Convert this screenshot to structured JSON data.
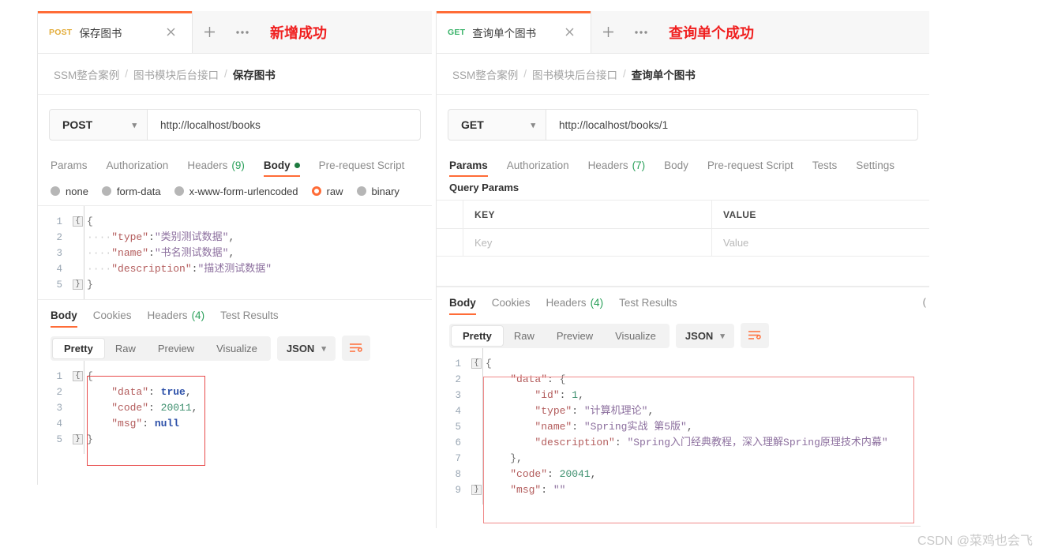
{
  "watermark": "CSDN @菜鸡也会飞",
  "panels": [
    {
      "id": "left",
      "tab": {
        "method": "POST",
        "title": "保存图书",
        "close_icon": "close-icon",
        "add_icon": "plus-icon",
        "more_icon": "ellipsis-icon"
      },
      "annotation": "新增成功",
      "breadcrumb": {
        "root": "SSM整合案例",
        "group": "图书模块后台接口",
        "current": "保存图书",
        "separator": "/"
      },
      "request": {
        "method": "POST",
        "url": "http://localhost/books",
        "tabs": [
          {
            "label": "Params",
            "count": "",
            "active": false,
            "dot": false
          },
          {
            "label": "Authorization",
            "count": "",
            "active": false,
            "dot": false
          },
          {
            "label": "Headers",
            "count": "(9)",
            "active": false,
            "dot": false
          },
          {
            "label": "Body",
            "count": "",
            "active": true,
            "dot": true
          },
          {
            "label": "Pre-request Script",
            "count": "",
            "active": false,
            "dot": false
          }
        ],
        "body_types": [
          {
            "label": "none",
            "selected": false
          },
          {
            "label": "form-data",
            "selected": false
          },
          {
            "label": "x-www-form-urlencoded",
            "selected": false
          },
          {
            "label": "raw",
            "selected": true
          },
          {
            "label": "binary",
            "selected": false
          }
        ],
        "body_lines": [
          {
            "n": "1",
            "fold": "open",
            "segments": [
              {
                "t": "{",
                "c": "brace"
              }
            ]
          },
          {
            "n": "2",
            "fold": "",
            "segments": [
              {
                "t": "····",
                "c": "dots"
              },
              {
                "t": "\"type\"",
                "c": "k"
              },
              {
                "t": ":",
                "c": "p"
              },
              {
                "t": "\"类别测试数据\"",
                "c": "s"
              },
              {
                "t": ",",
                "c": "p"
              }
            ]
          },
          {
            "n": "3",
            "fold": "",
            "segments": [
              {
                "t": "····",
                "c": "dots"
              },
              {
                "t": "\"name\"",
                "c": "k"
              },
              {
                "t": ":",
                "c": "p"
              },
              {
                "t": "\"书名测试数据\"",
                "c": "s"
              },
              {
                "t": ",",
                "c": "p"
              }
            ]
          },
          {
            "n": "4",
            "fold": "",
            "segments": [
              {
                "t": "····",
                "c": "dots"
              },
              {
                "t": "\"description\"",
                "c": "k"
              },
              {
                "t": ":",
                "c": "p"
              },
              {
                "t": "\"描述测试数据\"",
                "c": "s"
              }
            ]
          },
          {
            "n": "5",
            "fold": "close",
            "segments": [
              {
                "t": "}",
                "c": "brace"
              }
            ]
          }
        ]
      },
      "response": {
        "tabs": [
          {
            "label": "Body",
            "count": "",
            "active": true
          },
          {
            "label": "Cookies",
            "count": "",
            "active": false
          },
          {
            "label": "Headers",
            "count": "(4)",
            "active": false
          },
          {
            "label": "Test Results",
            "count": "",
            "active": false
          }
        ],
        "status": "",
        "view_modes": [
          {
            "label": "Pretty",
            "active": true
          },
          {
            "label": "Raw",
            "active": false
          },
          {
            "label": "Preview",
            "active": false
          },
          {
            "label": "Visualize",
            "active": false
          }
        ],
        "format": "JSON",
        "wrap_icon": "wrap-text-icon",
        "body_lines": [
          {
            "n": "1",
            "fold": "open",
            "segments": [
              {
                "t": "{",
                "c": "brace"
              }
            ]
          },
          {
            "n": "2",
            "fold": "",
            "segments": [
              {
                "t": "    ",
                "c": "p"
              },
              {
                "t": "\"data\"",
                "c": "k"
              },
              {
                "t": ": ",
                "c": "p"
              },
              {
                "t": "true",
                "c": "b"
              },
              {
                "t": ",",
                "c": "p"
              }
            ]
          },
          {
            "n": "3",
            "fold": "",
            "segments": [
              {
                "t": "    ",
                "c": "p"
              },
              {
                "t": "\"code\"",
                "c": "k"
              },
              {
                "t": ": ",
                "c": "p"
              },
              {
                "t": "20011",
                "c": "n"
              },
              {
                "t": ",",
                "c": "p"
              }
            ]
          },
          {
            "n": "4",
            "fold": "",
            "segments": [
              {
                "t": "    ",
                "c": "p"
              },
              {
                "t": "\"msg\"",
                "c": "k"
              },
              {
                "t": ": ",
                "c": "p"
              },
              {
                "t": "null",
                "c": "b"
              }
            ]
          },
          {
            "n": "5",
            "fold": "close",
            "segments": [
              {
                "t": "}",
                "c": "brace"
              }
            ]
          }
        ]
      }
    },
    {
      "id": "right",
      "tab": {
        "method": "GET",
        "title": "查询单个图书",
        "close_icon": "close-icon",
        "add_icon": "plus-icon",
        "more_icon": "ellipsis-icon"
      },
      "annotation": "查询单个成功",
      "breadcrumb": {
        "root": "SSM整合案例",
        "group": "图书模块后台接口",
        "current": "查询单个图书",
        "separator": "/"
      },
      "request": {
        "method": "GET",
        "url": "http://localhost/books/1",
        "tabs": [
          {
            "label": "Params",
            "count": "",
            "active": true,
            "dot": false
          },
          {
            "label": "Authorization",
            "count": "",
            "active": false,
            "dot": false
          },
          {
            "label": "Headers",
            "count": "(7)",
            "active": false,
            "dot": false
          },
          {
            "label": "Body",
            "count": "",
            "active": false,
            "dot": false
          },
          {
            "label": "Pre-request Script",
            "count": "",
            "active": false,
            "dot": false
          },
          {
            "label": "Tests",
            "count": "",
            "active": false,
            "dot": false
          },
          {
            "label": "Settings",
            "count": "",
            "active": false,
            "dot": false
          }
        ],
        "query_params": {
          "title": "Query Params",
          "headers": {
            "key": "KEY",
            "value": "VALUE"
          },
          "rows": [
            {
              "key_placeholder": "Key",
              "value_placeholder": "Value"
            }
          ]
        }
      },
      "response": {
        "tabs": [
          {
            "label": "Body",
            "count": "",
            "active": true
          },
          {
            "label": "Cookies",
            "count": "",
            "active": false
          },
          {
            "label": "Headers",
            "count": "(4)",
            "active": false
          },
          {
            "label": "Test Results",
            "count": "",
            "active": false
          }
        ],
        "status": "(",
        "view_modes": [
          {
            "label": "Pretty",
            "active": true
          },
          {
            "label": "Raw",
            "active": false
          },
          {
            "label": "Preview",
            "active": false
          },
          {
            "label": "Visualize",
            "active": false
          }
        ],
        "format": "JSON",
        "wrap_icon": "wrap-text-icon",
        "body_lines": [
          {
            "n": "1",
            "fold": "open",
            "segments": [
              {
                "t": "{",
                "c": "brace"
              }
            ]
          },
          {
            "n": "2",
            "fold": "",
            "segments": [
              {
                "t": "    ",
                "c": "p"
              },
              {
                "t": "\"data\"",
                "c": "k"
              },
              {
                "t": ": ",
                "c": "p"
              },
              {
                "t": "{",
                "c": "brace"
              }
            ]
          },
          {
            "n": "3",
            "fold": "",
            "segments": [
              {
                "t": "        ",
                "c": "p"
              },
              {
                "t": "\"id\"",
                "c": "k"
              },
              {
                "t": ": ",
                "c": "p"
              },
              {
                "t": "1",
                "c": "n"
              },
              {
                "t": ",",
                "c": "p"
              }
            ]
          },
          {
            "n": "4",
            "fold": "",
            "segments": [
              {
                "t": "        ",
                "c": "p"
              },
              {
                "t": "\"type\"",
                "c": "k"
              },
              {
                "t": ": ",
                "c": "p"
              },
              {
                "t": "\"计算机理论\"",
                "c": "s"
              },
              {
                "t": ",",
                "c": "p"
              }
            ]
          },
          {
            "n": "5",
            "fold": "",
            "segments": [
              {
                "t": "        ",
                "c": "p"
              },
              {
                "t": "\"name\"",
                "c": "k"
              },
              {
                "t": ": ",
                "c": "p"
              },
              {
                "t": "\"Spring实战 第5版\"",
                "c": "s"
              },
              {
                "t": ",",
                "c": "p"
              }
            ]
          },
          {
            "n": "6",
            "fold": "",
            "segments": [
              {
                "t": "        ",
                "c": "p"
              },
              {
                "t": "\"description\"",
                "c": "k"
              },
              {
                "t": ": ",
                "c": "p"
              },
              {
                "t": "\"Spring入门经典教程，深入理解Spring原理技术内幕\"",
                "c": "s"
              }
            ]
          },
          {
            "n": "7",
            "fold": "",
            "segments": [
              {
                "t": "    ",
                "c": "p"
              },
              {
                "t": "}",
                "c": "brace"
              },
              {
                "t": ",",
                "c": "p"
              }
            ]
          },
          {
            "n": "8",
            "fold": "",
            "segments": [
              {
                "t": "    ",
                "c": "p"
              },
              {
                "t": "\"code\"",
                "c": "k"
              },
              {
                "t": ": ",
                "c": "p"
              },
              {
                "t": "20041",
                "c": "n"
              },
              {
                "t": ",",
                "c": "p"
              }
            ]
          },
          {
            "n": "9",
            "fold": "close",
            "segments": [
              {
                "t": "    ",
                "c": "p"
              },
              {
                "t": "\"msg\"",
                "c": "k"
              },
              {
                "t": ": ",
                "c": "p"
              },
              {
                "t": "\"\"",
                "c": "s"
              }
            ]
          }
        ]
      }
    }
  ]
}
